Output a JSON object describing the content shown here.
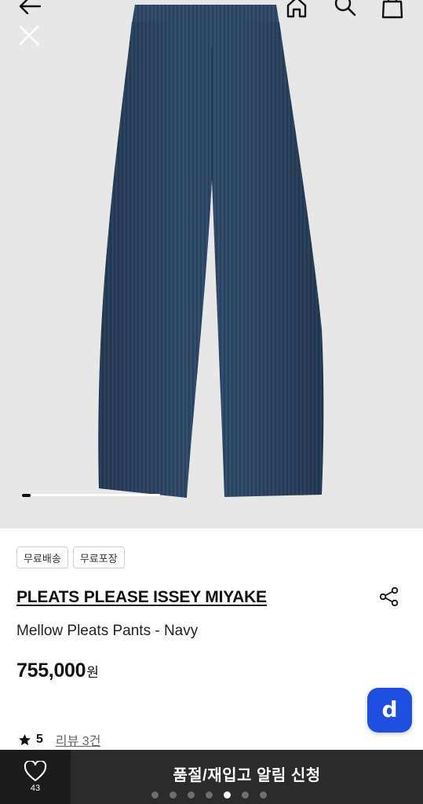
{
  "hero": {
    "image_alt": "",
    "carousel_progress": 0.06
  },
  "nav": {
    "back_icon": "arrow-left-icon",
    "close_icon": "close-icon",
    "home_icon": "home-icon",
    "search_icon": "search-icon",
    "bag_icon": "shopping-bag-icon"
  },
  "tags": [
    "무료배송",
    "무료포장"
  ],
  "product": {
    "brand": "PLEATS PLEASE ISSEY MIYAKE",
    "name": "Mellow Pleats Pants - Navy",
    "price": "755,000",
    "currency": "원"
  },
  "rating": {
    "score": "5",
    "reviews": "리뷰 3건"
  },
  "actions": {
    "wish_count": "43",
    "cta_label": "품절/재입고 알림 신청"
  },
  "fab": {
    "label": "d",
    "color": "#1f4fe0"
  },
  "pager": {
    "count": 7,
    "active_index": 4
  },
  "colors": {
    "navy": "#2f4866",
    "bottom_dark": "#1c1c1c",
    "cta_bg": "#2b2b2b"
  }
}
